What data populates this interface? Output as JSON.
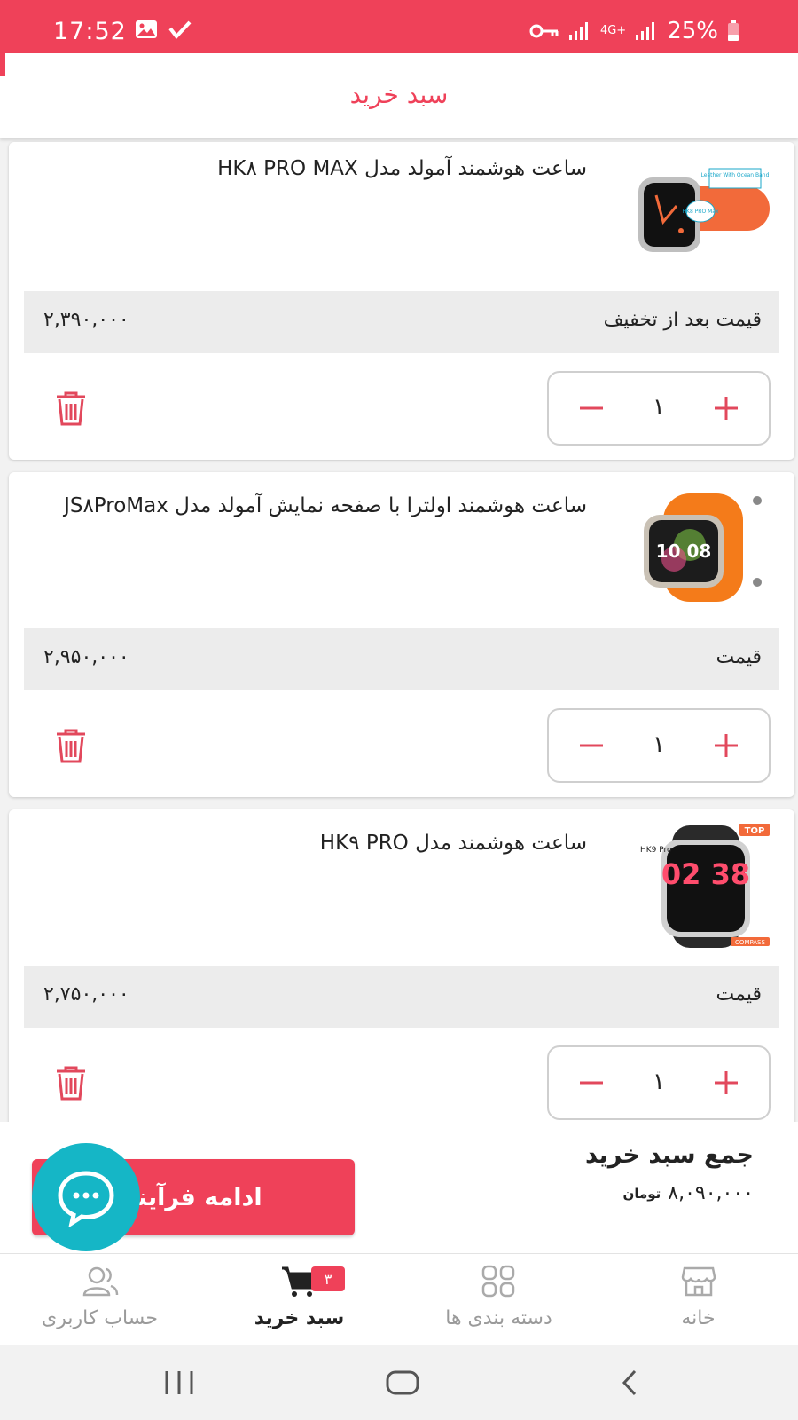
{
  "status_bar": {
    "time": "17:52",
    "network": "4G+",
    "battery": "25%",
    "icons": [
      "image-icon",
      "check-icon",
      "key-icon",
      "signal-icon",
      "battery-icon"
    ]
  },
  "header": {
    "title": "سبد خرید"
  },
  "cart": {
    "items": [
      {
        "title": "ساعت هوشمند آمولد مدل HK۸ PRO MAX",
        "price_label": "قیمت بعد از تخفیف",
        "price": "۲,۳۹۰,۰۰۰",
        "quantity": "۱",
        "image_text": "HK8 PRO Max",
        "image_subtext": "Leather With Ocean Band"
      },
      {
        "title": "ساعت هوشمند اولترا با صفحه نمایش آمولد مدل JS۸ProMax",
        "price_label": "قیمت",
        "price": "۲,۹۵۰,۰۰۰",
        "quantity": "۱",
        "image_text": "10 08",
        "image_subtext": ""
      },
      {
        "title": "ساعت هوشمند مدل HK۹ PRO",
        "price_label": "قیمت",
        "price": "۲,۷۵۰,۰۰۰",
        "quantity": "۱",
        "image_text": "02 38",
        "image_subtext": "HK9 Pro",
        "image_tag": "TOP",
        "image_footer": "COMPASS"
      }
    ]
  },
  "summary": {
    "title": "جمع سبد خرید",
    "total": "۸,۰۹۰,۰۰۰",
    "unit": "تومان",
    "continue_label": "ادامه فرآیند"
  },
  "bottom_nav": {
    "items": [
      {
        "label": "خانه",
        "icon": "home-icon"
      },
      {
        "label": "دسته بندی ها",
        "icon": "categories-icon"
      },
      {
        "label": "سبد خرید",
        "icon": "cart-icon",
        "badge": "۳",
        "active": true
      },
      {
        "label": "حساب کاربری",
        "icon": "users-icon"
      }
    ]
  },
  "colors": {
    "accent": "#ef4159",
    "chat": "#15b6c6",
    "price_bg": "#ececec"
  }
}
